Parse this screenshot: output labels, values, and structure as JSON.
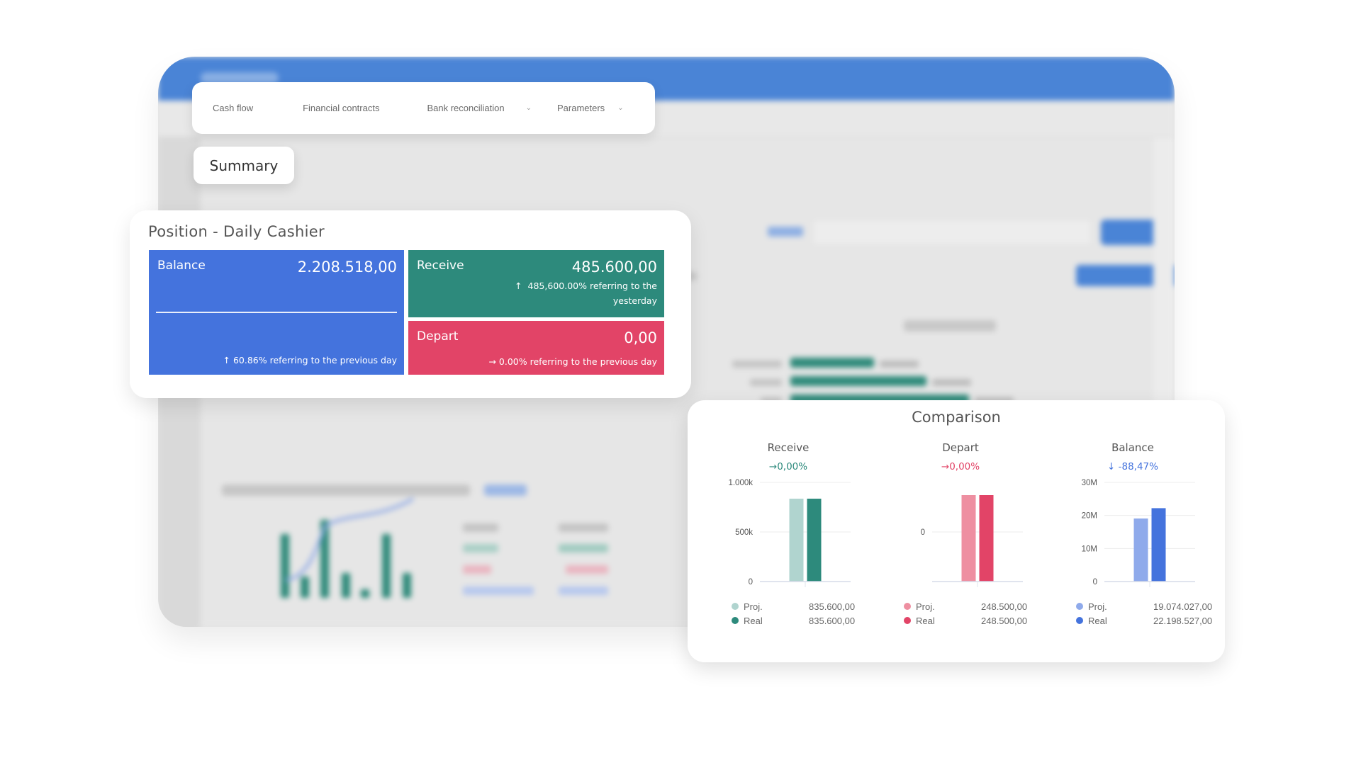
{
  "nav": {
    "items": [
      {
        "label": "Cash flow",
        "has_dropdown": false
      },
      {
        "label": "Financial contracts",
        "has_dropdown": false
      },
      {
        "label": "Bank reconciliation",
        "has_dropdown": true
      },
      {
        "label": "Parameters",
        "has_dropdown": true
      }
    ],
    "chevron_icon": "⌄"
  },
  "summary_tab": {
    "label": "Summary"
  },
  "position": {
    "title": "Position - Daily Cashier",
    "balance": {
      "label": "Balance",
      "value": "2.208.518,00",
      "arrow": "↑",
      "note": "60.86% referring to the previous day",
      "color": "#4473dd"
    },
    "receive": {
      "label": "Receive",
      "value": "485.600,00",
      "arrow": "↑",
      "note": "485,600.00% referring to the yesterday",
      "color": "#2d8a7c"
    },
    "depart": {
      "label": "Depart",
      "value": "0,00",
      "arrow": "→",
      "note": "0.00% referring to the previous day",
      "color": "#e24467"
    }
  },
  "comparison": {
    "title": "Comparison",
    "legend_labels": {
      "proj": "Proj.",
      "real": "Real"
    }
  },
  "chart_data": [
    {
      "type": "bar",
      "title": "Receive",
      "change": "→0,00%",
      "change_color": "#2d8a7c",
      "categories": [
        "Proj.",
        "Real"
      ],
      "values": [
        835600,
        835600
      ],
      "value_labels": [
        "835.600,00",
        "835.600,00"
      ],
      "colors": [
        "#b0d4cf",
        "#2d8a7c"
      ],
      "yticks": [
        0,
        500000,
        1000000
      ],
      "ytick_labels": [
        "0",
        "500k",
        "1.000k"
      ],
      "ylim": [
        0,
        1000000
      ]
    },
    {
      "type": "bar",
      "title": "Depart",
      "change": "→0,00%",
      "change_color": "#e24467",
      "categories": [
        "Proj.",
        "Real"
      ],
      "values": [
        248500,
        248500
      ],
      "value_labels": [
        "248.500,00",
        "248.500,00"
      ],
      "colors": [
        "#ee8fa1",
        "#e24467"
      ],
      "yticks": [
        0
      ],
      "ytick_labels": [
        "0"
      ],
      "ylim": [
        0,
        250000
      ]
    },
    {
      "type": "bar",
      "title": "Balance",
      "change": "↓ -88,47%",
      "change_color": "#4473dd",
      "categories": [
        "Proj.",
        "Real"
      ],
      "values": [
        19074027,
        22198527
      ],
      "value_labels": [
        "19.074.027,00",
        "22.198.527,00"
      ],
      "colors": [
        "#8faaeb",
        "#4473dd"
      ],
      "yticks": [
        0,
        10000000,
        20000000,
        30000000
      ],
      "ytick_labels": [
        "0",
        "10M",
        "20M",
        "30M"
      ],
      "ylim": [
        0,
        30000000
      ]
    }
  ],
  "colors": {
    "app_bar": "#4a84d6",
    "balance": "#4473dd",
    "receive": "#2d8a7c",
    "depart": "#e24467"
  }
}
